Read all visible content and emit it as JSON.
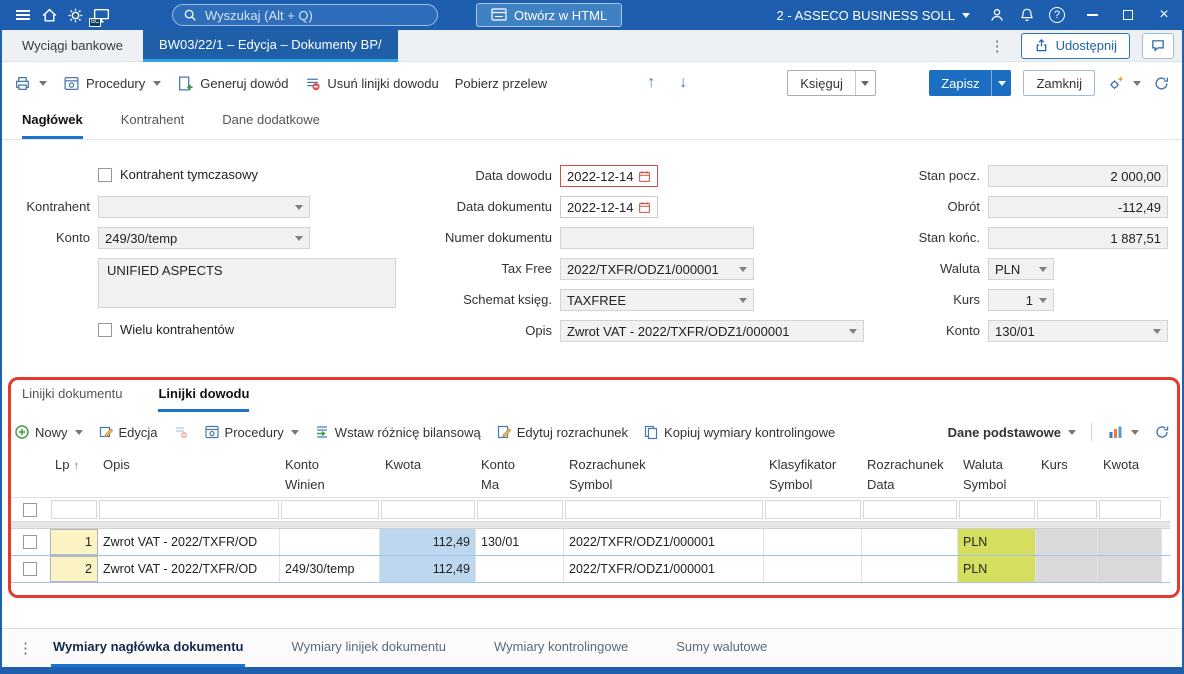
{
  "titlebar": {
    "search_placeholder": "Wyszukaj (Alt + Q)",
    "open_html_label": "Otwórz w HTML",
    "company_selector": "2 - ASSECO BUSINESS SOLL",
    "bc_badge": "BC"
  },
  "tabbar": {
    "background_tab": "Wyciągi bankowe",
    "active_tab": "BW03/22/1 – Edycja – Dokumenty BP/",
    "share_button": "Udostępnij"
  },
  "toolbar": {
    "procedury": "Procedury",
    "generuj_dowod": "Generuj dowód",
    "usun_linijki": "Usuń linijki dowodu",
    "pobierz_przelew": "Pobierz przelew",
    "ksieguj": "Księguj",
    "zapisz": "Zapisz",
    "zamknij": "Zamknij"
  },
  "header_tabs": [
    {
      "label": "Nagłówek"
    },
    {
      "label": "Kontrahent"
    },
    {
      "label": "Dane dodatkowe"
    }
  ],
  "form": {
    "kontrahent_tymczasowy_label": "Kontrahent tymczasowy",
    "wielu_kontrahentow_label": "Wielu kontrahentów",
    "kontrahent_label": "Kontrahent",
    "kontrahent_value": "",
    "konto_label": "Konto",
    "konto_value": "249/30/temp",
    "kontrahent_name": "UNIFIED ASPECTS",
    "data_dowodu_label": "Data dowodu",
    "data_dowodu_value": "2022-12-14",
    "data_dokumentu_label": "Data dokumentu",
    "data_dokumentu_value": "2022-12-14",
    "numer_dokumentu_label": "Numer dokumentu",
    "numer_dokumentu_value": "",
    "tax_free_label": "Tax Free",
    "tax_free_value": "2022/TXFR/ODZ1/000001",
    "schemat_ksieg_label": "Schemat księg.",
    "schemat_ksieg_value": "TAXFREE",
    "opis_label": "Opis",
    "opis_value": "Zwrot VAT - 2022/TXFR/ODZ1/000001",
    "stan_pocz_label": "Stan pocz.",
    "stan_pocz_value": "2 000,00",
    "obrot_label": "Obrót",
    "obrot_value": "-112,49",
    "stan_konc_label": "Stan końc.",
    "stan_konc_value": "1 887,51",
    "waluta_label": "Waluta",
    "waluta_value": "PLN",
    "kurs_label": "Kurs",
    "kurs_value": "1",
    "konto2_label": "Konto",
    "konto2_value": "130/01"
  },
  "lines": {
    "tabs": [
      {
        "label": "Linijki dokumentu"
      },
      {
        "label": "Linijki dowodu"
      }
    ],
    "toolbar": {
      "nowy": "Nowy",
      "edycja": "Edycja",
      "procedury": "Procedury",
      "wstaw": "Wstaw różnicę bilansową",
      "edytuj_rozrachunek": "Edytuj rozrachunek",
      "kopiuj_wymiary": "Kopiuj wymiary kontrolingowe",
      "dane_podstawowe": "Dane podstawowe"
    },
    "table": {
      "columns": [
        {
          "l1": "Lp",
          "l2": ""
        },
        {
          "l1": "Opis",
          "l2": ""
        },
        {
          "l1": "Konto",
          "l2": "Winien"
        },
        {
          "l1": "Kwota",
          "l2": ""
        },
        {
          "l1": "Konto",
          "l2": "Ma"
        },
        {
          "l1": "Rozrachunek",
          "l2": "Symbol"
        },
        {
          "l1": "Klasyfikator",
          "l2": "Symbol"
        },
        {
          "l1": "Rozrachunek",
          "l2": "Data"
        },
        {
          "l1": "Waluta",
          "l2": "Symbol"
        },
        {
          "l1": "",
          "l2": "Kurs"
        },
        {
          "l1": "",
          "l2": "Kwota"
        }
      ],
      "rows": [
        {
          "lp": "1",
          "opis": "Zwrot VAT - 2022/TXFR/OD",
          "konto_winien": "",
          "kwota": "112,49",
          "konto_ma": "130/01",
          "rozrachunek_symbol": "2022/TXFR/ODZ1/000001",
          "klasyfikator_symbol": "",
          "rozrachunek_data": "",
          "waluta_symbol": "PLN",
          "kurs": "",
          "kwota_waluta": ""
        },
        {
          "lp": "2",
          "opis": "Zwrot VAT - 2022/TXFR/OD",
          "konto_winien": "249/30/temp",
          "kwota": "112,49",
          "konto_ma": "",
          "rozrachunek_symbol": "2022/TXFR/ODZ1/000001",
          "klasyfikator_symbol": "",
          "rozrachunek_data": "",
          "waluta_symbol": "PLN",
          "kurs": "",
          "kwota_waluta": ""
        }
      ]
    }
  },
  "bottom_tabs": [
    {
      "label": "Wymiary nagłówka dokumentu"
    },
    {
      "label": "Wymiary linijek dokumentu"
    },
    {
      "label": "Wymiary kontrolingowe"
    },
    {
      "label": "Sumy walutowe"
    }
  ],
  "icons": {
    "arrow_up": "↑",
    "arrow_down": "↓",
    "more_vertical": "⋮",
    "close": "×",
    "question": "?",
    "sort_asc": "↑"
  }
}
